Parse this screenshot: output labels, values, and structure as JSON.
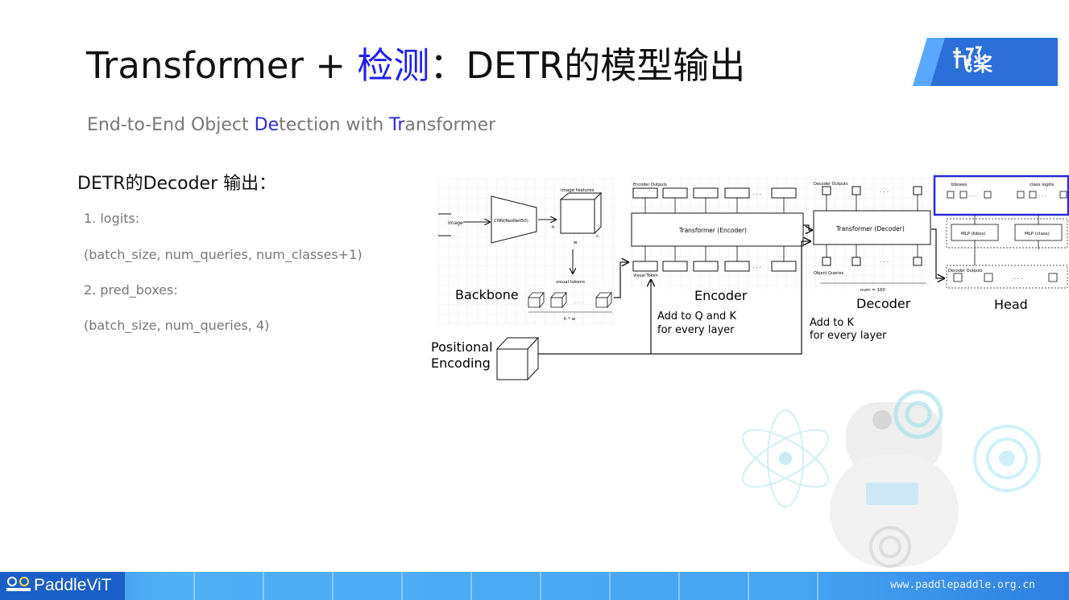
{
  "slide": {
    "title_en": "Transformer + ",
    "title_cn_blue": "检测",
    "title_rest": "：DETR的模型输出",
    "subtitle_1": "End-to-End Object ",
    "subtitle_hl1": "De",
    "subtitle_2": "tection with ",
    "subtitle_hl2": "Tr",
    "subtitle_3": "ansformer",
    "logo_text": "飞桨"
  },
  "left": {
    "heading": "DETR的Decoder 输出：",
    "lines": [
      "1. logits:",
      "(batch_size, num_queries, num_classes+1)",
      "2. pred_boxes:",
      "(batch_size, num_queries, 4)"
    ]
  },
  "figure": {
    "backbone": {
      "image": "image",
      "cnn": "CNN(ResNet50)",
      "image_features": "image features",
      "h": "h",
      "w": "w",
      "c": "c",
      "visual_tokens": "visual tokens",
      "hw": "h * w",
      "label": "Backbone"
    },
    "encoder": {
      "outputs": "Encoder Outputs",
      "block": "Transformer (Encoder)",
      "visual_token": "Visual Token",
      "label": "Encoder",
      "note1": "Add to Q and K",
      "note2": "for every layer"
    },
    "decoder": {
      "outputs": "Decoder Outputs",
      "block": "Transformer (Decoder)",
      "queries": "Object Queries",
      "num": "num = 100",
      "label": "Decoder",
      "note1": "Add to K",
      "note2": "for every layer"
    },
    "head": {
      "bboxes": "bboxes",
      "class_logits": "class logits",
      "mlp_bbox": "MLP (bbox)",
      "mlp_class": "MLP (class)",
      "dec_outputs": "Decoder Outputs",
      "label": "Head"
    },
    "dots": "· · ·",
    "positional1": "Positional",
    "positional2": "Encoding"
  },
  "footer": {
    "brand": "PaddleViT",
    "url": "www.paddlepaddle.org.cn"
  },
  "colors": {
    "blue_title": "#1f1ff0",
    "footer_dark": "#2e7fe0",
    "footer_light": "#4fb0f5",
    "head_box": "#2a2ad6"
  }
}
